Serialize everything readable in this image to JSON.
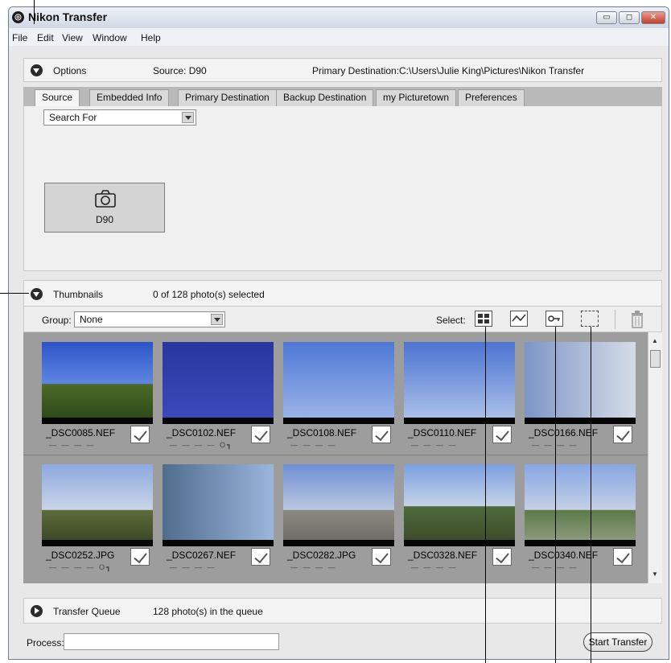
{
  "window": {
    "title": "Nikon Transfer",
    "app_icon": "nikon-transfer-app-icon",
    "buttons": {
      "minimize": "▭",
      "maximize": "◻",
      "close": "✕"
    }
  },
  "menu": [
    "File",
    "Edit",
    "View",
    "Window",
    "Help"
  ],
  "options": {
    "label": "Options",
    "source": "Source: D90",
    "primary_destination_label": "Primary Destination:",
    "primary_destination_path": "C:\\Users\\Julie King\\Pictures\\Nikon Transfer"
  },
  "tabs": [
    "Source",
    "Embedded Info",
    "Primary Destination",
    "Backup Destination",
    "my Picturetown",
    "Preferences"
  ],
  "source_panel": {
    "search_for": "Search For",
    "device_label": "D90"
  },
  "thumbnails": {
    "label": "Thumbnails",
    "selection_status": "0 of 128 photo(s) selected",
    "group_label": "Group:",
    "group_value": "None",
    "select_label": "Select:",
    "toolbar_icons": [
      "select-all-icon",
      "select-new-icon",
      "select-protected-icon",
      "deselect-icon",
      "delete-icon"
    ],
    "photos": [
      {
        "name": "_DSC0085.NEF",
        "protected": false
      },
      {
        "name": "_DSC0102.NEF",
        "protected": true
      },
      {
        "name": "_DSC0108.NEF",
        "protected": false
      },
      {
        "name": "_DSC0110.NEF",
        "protected": false
      },
      {
        "name": "_DSC0166.NEF",
        "protected": false
      },
      {
        "name": "_DSC0252.JPG",
        "protected": true
      },
      {
        "name": "_DSC0267.NEF",
        "protected": false
      },
      {
        "name": "_DSC0282.JPG",
        "protected": false
      },
      {
        "name": "_DSC0328.NEF",
        "protected": false
      },
      {
        "name": "_DSC0340.NEF",
        "protected": false
      }
    ],
    "rating_dashes": "— — — —",
    "key_glyph": "O┓"
  },
  "transfer_queue": {
    "label": "Transfer Queue",
    "status": "128 photo(s) in the queue"
  },
  "process": {
    "label": "Process:",
    "value": ""
  },
  "start_transfer": "Start Transfer",
  "colors": {
    "sky": "#3e63c8",
    "title_gradient_top": "#eef2f7",
    "grid_background": "#9d9d9d"
  }
}
